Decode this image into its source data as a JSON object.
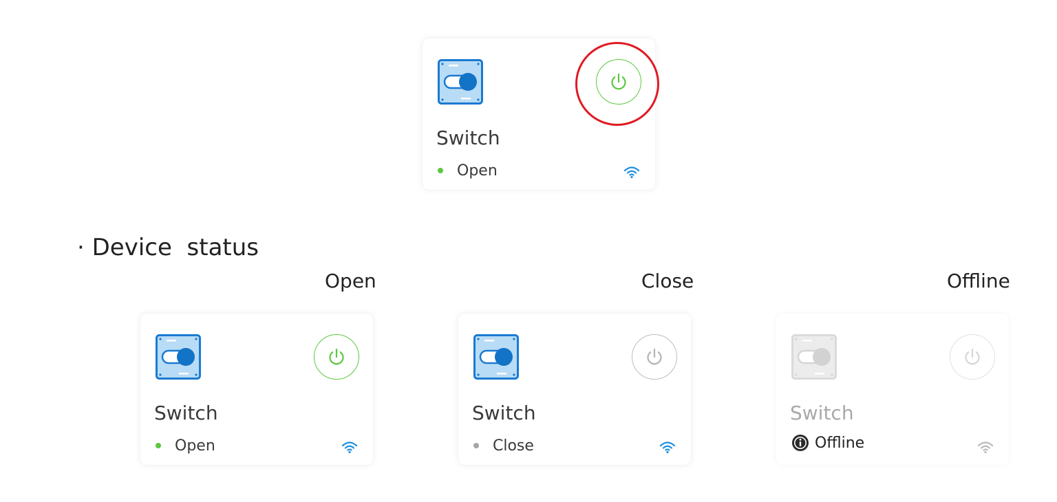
{
  "colors": {
    "online_green": "#5cc73f",
    "device_blue": "#1273c7",
    "wifi_blue": "#1b8fe0",
    "offline_grey": "#bdbdbd",
    "highlight_red": "#e01a22"
  },
  "hero_card": {
    "title": "Switch",
    "status": "Open",
    "state": "open",
    "icons": [
      "switch-device-icon",
      "power-icon",
      "wifi-icon"
    ]
  },
  "section": {
    "bullet": "·",
    "heading": "Device  status"
  },
  "state_cards": [
    {
      "caption": "Open",
      "title": "Switch",
      "status": "Open",
      "state": "open"
    },
    {
      "caption": "Close",
      "title": "Switch",
      "status": "Close",
      "state": "close"
    },
    {
      "caption": "Offline",
      "title": "Switch",
      "status": "Offline",
      "state": "offline"
    }
  ]
}
